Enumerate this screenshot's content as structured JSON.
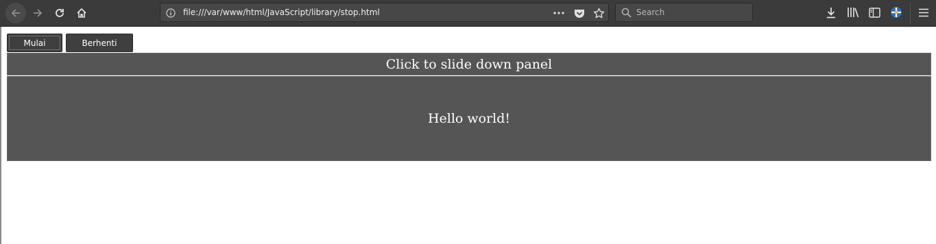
{
  "browser": {
    "url": "file:///var/www/html/JavaScript/library/stop.html",
    "search_placeholder": "Search",
    "icons": {
      "back": "back-arrow-icon",
      "forward": "forward-arrow-icon",
      "reload": "reload-icon",
      "home": "home-icon",
      "info": "info-icon",
      "more": "more-dots-icon",
      "pocket": "pocket-icon",
      "bookmark": "bookmark-star-icon",
      "search": "search-icon",
      "downloads": "download-icon",
      "library": "library-icon",
      "sidebar": "sidebar-icon",
      "extension": "extension-icon",
      "menu": "hamburger-menu-icon"
    }
  },
  "page": {
    "start_button": "Mulai",
    "stop_button": "Berhenti",
    "flip_text": "Click to slide down panel",
    "panel_text": "Hello world!"
  },
  "colors": {
    "toolbar": "#3b3b3b",
    "panel": "#555555",
    "button": "#3f3f3f"
  }
}
